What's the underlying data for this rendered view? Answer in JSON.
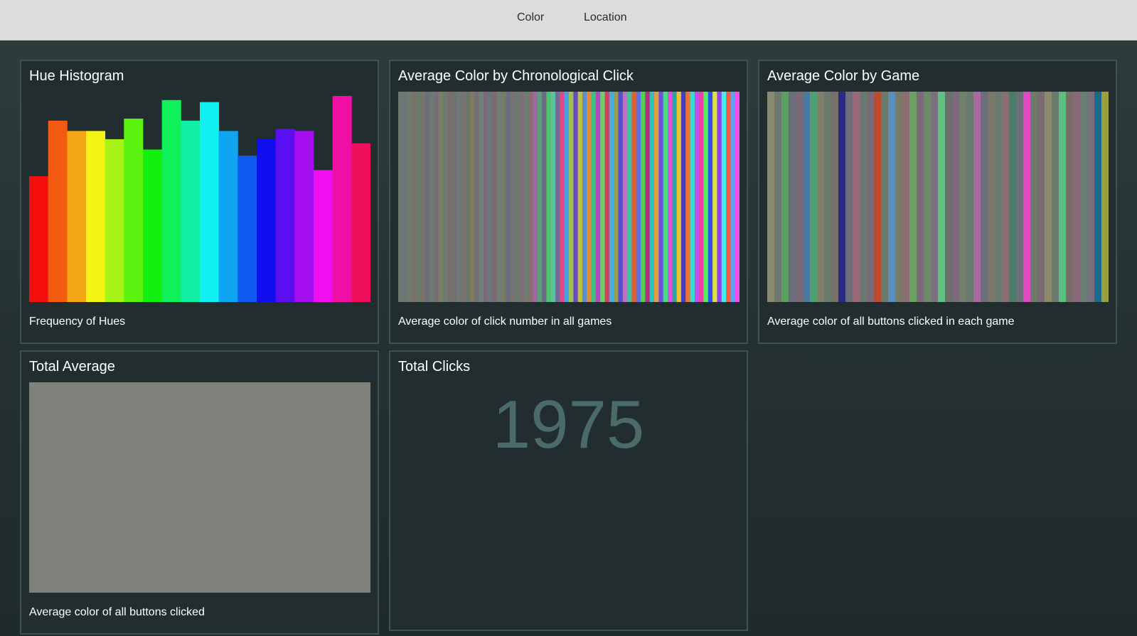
{
  "nav": {
    "items": [
      "Color",
      "Location"
    ]
  },
  "hue_histogram": {
    "title": "Hue Histogram",
    "caption": "Frequency of Hues"
  },
  "chronological": {
    "title": "Average Color by Chronological Click",
    "caption": "Average color of click number in all games"
  },
  "by_game": {
    "title": "Average Color by Game",
    "caption": "Average color of all buttons clicked in each game"
  },
  "total_average": {
    "title": "Total Average",
    "caption": "Average color of all buttons clicked",
    "color": "#80817c"
  },
  "total_clicks": {
    "title": "Total Clicks",
    "value": "1975"
  },
  "chart_data": [
    {
      "type": "bar",
      "values": [
        0.61,
        0.88,
        0.83,
        0.83,
        0.79,
        0.89,
        0.74,
        0.98,
        0.88,
        0.97,
        0.83,
        0.71,
        0.79,
        0.84,
        0.83,
        0.64,
        1.0,
        0.77
      ],
      "colors": [
        "#f50e0e",
        "#f35a12",
        "#f3a514",
        "#f3f314",
        "#a7f314",
        "#5af30f",
        "#11f00f",
        "#0ff05a",
        "#0ff0a5",
        "#0ff0f0",
        "#0fa5f0",
        "#0f5af0",
        "#0f0ff0",
        "#5a0ff0",
        "#a50ff0",
        "#f00ff0",
        "#f00fa5",
        "#f00f5a"
      ]
    },
    {
      "type": "heatmap",
      "colors": [
        "#6b7a70",
        "#6a7676",
        "#707a6a",
        "#7a7068",
        "#6a7a6e",
        "#787468",
        "#6e6e7a",
        "#6a7a74",
        "#7a6e76",
        "#788066",
        "#6e7a70",
        "#7a6e6a",
        "#767072",
        "#6c7a78",
        "#7a7070",
        "#6a7868",
        "#827a5e",
        "#6e7276",
        "#72807a",
        "#7a6a78",
        "#6a767a",
        "#806a72",
        "#6a8072",
        "#7a7a66",
        "#6a6e80",
        "#787274",
        "#6a7a6e",
        "#7c6e78",
        "#6e7e72",
        "#8a6e70",
        "#9a6aa0",
        "#5aa07a",
        "#6a6a8a",
        "#4ec26a",
        "#5ec0a0",
        "#7a6a9a",
        "#e04a8a",
        "#4aa0e0",
        "#a0c050",
        "#6a4ac0",
        "#c0c040",
        "#5a90d0",
        "#e08a40",
        "#40c080",
        "#b04ac0",
        "#6ad06a",
        "#d04060",
        "#40b0e0",
        "#9a9a50",
        "#5050d0",
        "#c070c0",
        "#40c0a0",
        "#e06030",
        "#6070e0",
        "#50d050",
        "#b03080",
        "#30c0c0",
        "#e0a040",
        "#7050e0",
        "#40e080",
        "#e050e0",
        "#30a0a0",
        "#f0c030",
        "#4040c0",
        "#f07030",
        "#30e0d0",
        "#c050f0",
        "#f040a0",
        "#50f060",
        "#3050f0",
        "#e0e040",
        "#9040f0",
        "#40f0f0",
        "#f06040",
        "#60a0f0",
        "#f050f0"
      ]
    },
    {
      "type": "heatmap",
      "colors": [
        "#8a8a70",
        "#6e7a70",
        "#5aa060",
        "#6a6e7a",
        "#7a6a74",
        "#4a7aa0",
        "#4ea070",
        "#80806a",
        "#6a7a6e",
        "#7a6e68",
        "#2a2a80",
        "#6e6e78",
        "#9a6a7a",
        "#6a7a6e",
        "#7a6a74",
        "#c04a30",
        "#6a7a6a",
        "#5a90c0",
        "#7a7a68",
        "#8a6e72",
        "#6aa060",
        "#7a6a7a",
        "#6e8a6a",
        "#7a7080",
        "#60c080",
        "#6e6e6e",
        "#7a6a7a",
        "#70806a",
        "#6a7a70",
        "#aa6aa0",
        "#6a6e78",
        "#7a7868",
        "#6a7a70",
        "#8a6e6e",
        "#4a7a6a",
        "#6e6e7a",
        "#e04ac0",
        "#6e7a6a",
        "#7a6a74",
        "#8a8a6a",
        "#6a7a70",
        "#5ac080",
        "#7a6e6a",
        "#8a6a7a",
        "#6a7e72",
        "#7a6e7e",
        "#1a6a8a",
        "#9aa040"
      ]
    }
  ]
}
